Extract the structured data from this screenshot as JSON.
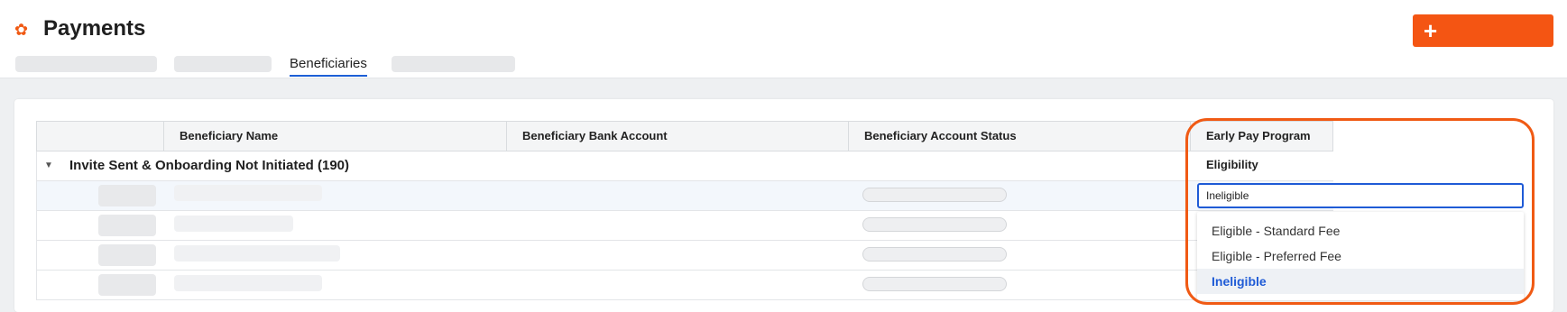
{
  "header": {
    "title": "Payments",
    "create_button_symbol": "+",
    "create_button_label": ""
  },
  "tabs": [
    {
      "label": "",
      "placeholder": true
    },
    {
      "label": "",
      "placeholder": true
    },
    {
      "label": "Beneficiaries",
      "active": true
    },
    {
      "label": "",
      "placeholder": true
    }
  ],
  "grid": {
    "columns": [
      "",
      "Beneficiary Name",
      "Beneficiary Bank Account",
      "Beneficiary Account Status",
      "Early Pay Program Eligibility"
    ],
    "group_label": "Invite Sent & Onboarding Not Initiated (190)",
    "rows": [
      {
        "eligibility_value": "Ineligible"
      },
      {},
      {},
      {}
    ]
  },
  "dropdown": {
    "current_value": "Ineligible",
    "options": [
      "Eligible - Standard Fee",
      "Eligible - Preferred Fee",
      "Ineligible"
    ],
    "selected_index": 2
  },
  "colors": {
    "accent": "#f45513",
    "link": "#1f5bd6",
    "highlight": "#f05a14"
  },
  "icons": {
    "app": "gear-icon",
    "create": "plus-icon",
    "group_toggle": "caret-down-icon"
  }
}
